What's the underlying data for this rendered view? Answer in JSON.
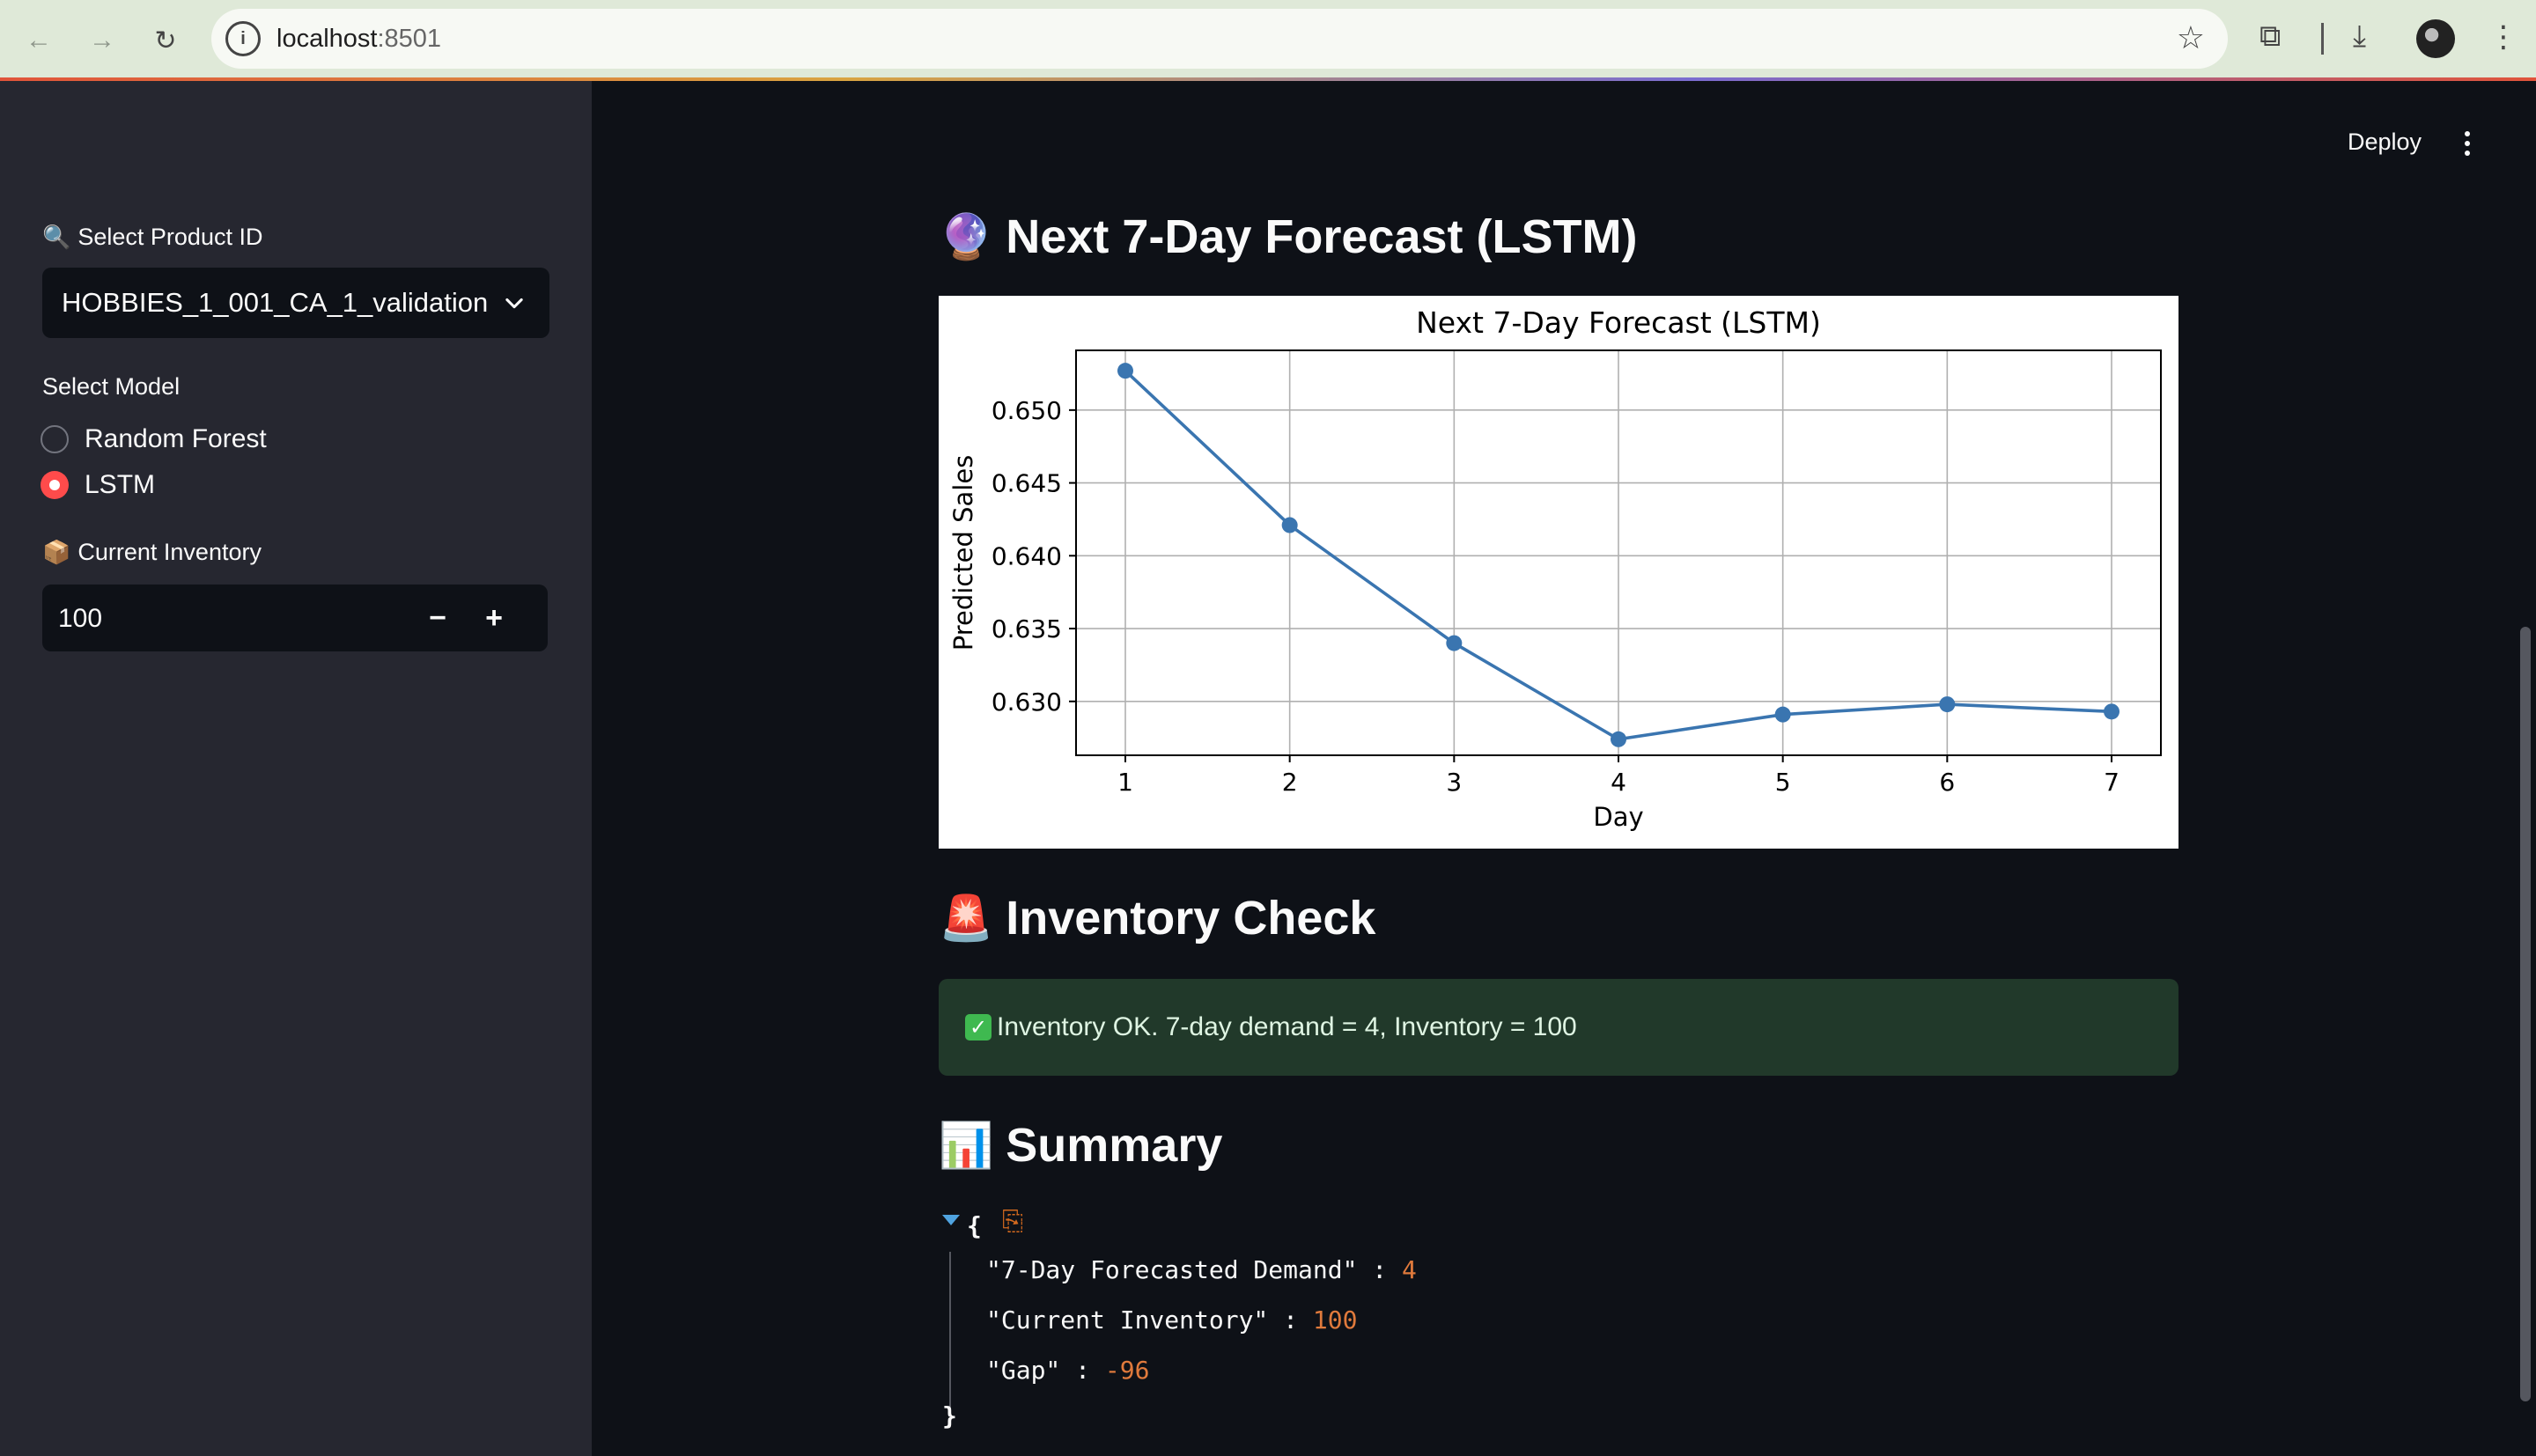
{
  "browser": {
    "url_host": "localhost",
    "url_port": ":8501"
  },
  "sidebar": {
    "product_label": "Select Product ID",
    "product_value": "HOBBIES_1_001_CA_1_validation",
    "model_label": "Select Model",
    "models": [
      {
        "label": "Random Forest",
        "selected": false
      },
      {
        "label": "LSTM",
        "selected": true
      }
    ],
    "inventory_label": "Current Inventory",
    "inventory_value": "100",
    "decrement": "−",
    "increment": "+"
  },
  "header": {
    "deploy_label": "Deploy"
  },
  "forecast_section": {
    "title": "Next 7-Day Forecast (LSTM)",
    "emoji": "🔮"
  },
  "chart_data": {
    "type": "line",
    "title": "Next 7-Day Forecast (LSTM)",
    "xlabel": "Day",
    "ylabel": "Predicted Sales",
    "x": [
      1,
      2,
      3,
      4,
      5,
      6,
      7
    ],
    "series": [
      {
        "values": [
          0.6527,
          0.6421,
          0.634,
          0.6274,
          0.6291,
          0.6298,
          0.6293
        ]
      }
    ],
    "xlim": [
      0.7,
      7.3
    ],
    "ylim": [
      0.6263,
      0.6541
    ],
    "xticks": [
      "1",
      "2",
      "3",
      "4",
      "5",
      "6",
      "7"
    ],
    "yticks": [
      "0.630",
      "0.635",
      "0.640",
      "0.645",
      "0.650"
    ],
    "ytick_values": [
      0.63,
      0.635,
      0.64,
      0.645,
      0.65
    ],
    "grid": true,
    "color": "#3a75b0"
  },
  "inventory_section": {
    "title": "Inventory Check",
    "emoji": "🚨",
    "message": "Inventory OK. 7-day demand = 4, Inventory = 100"
  },
  "summary_section": {
    "title": "Summary",
    "emoji": "📊",
    "entries": [
      {
        "key": "\"7-Day Forecasted Demand\"",
        "value": "4"
      },
      {
        "key": "\"Current Inventory\"",
        "value": "100"
      },
      {
        "key": "\"Gap\"",
        "value": "-96"
      }
    ],
    "brace_open": "{",
    "brace_close": "}",
    "colon": " : "
  }
}
